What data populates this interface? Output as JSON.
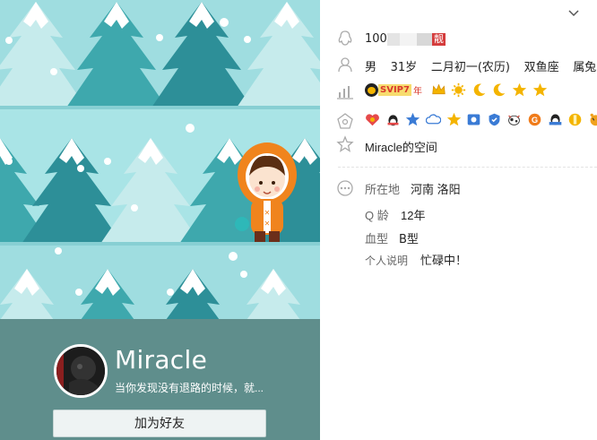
{
  "profile": {
    "nickname": "Miracle",
    "signature": "当你发现没有退路的时候，就...",
    "add_friend_label": "加为好友"
  },
  "info": {
    "qq_number": "100",
    "liang_badge": "靓",
    "gender": "男",
    "age": "31岁",
    "birthday": "二月初一(农历)",
    "zodiac": "双鱼座",
    "chinese_zodiac": "属兔",
    "svip_label": "SVIP7",
    "svip_year": "年",
    "space_link": "Miracle的空间",
    "location_label": "所在地",
    "location_value": "河南 洛阳",
    "qage_label": "Q 龄",
    "qage_value": "12年",
    "blood_label": "血型",
    "blood_value": "B型",
    "status_label": "个人说明",
    "status_value": "忙碌中！"
  },
  "icons": {
    "header": "chevron-down-icon",
    "rows": [
      "qq-penguin-icon",
      "person-icon",
      "level-chart-icon",
      "service-gift-icon",
      "star-icon",
      "more-icon"
    ]
  },
  "colors": {
    "left_bg": "#a9e4e6",
    "profile_bg": "#5f8e8c",
    "level_gold": "#f4b400",
    "svip_red": "#d9372b",
    "liang_red": "#d43c3c"
  }
}
